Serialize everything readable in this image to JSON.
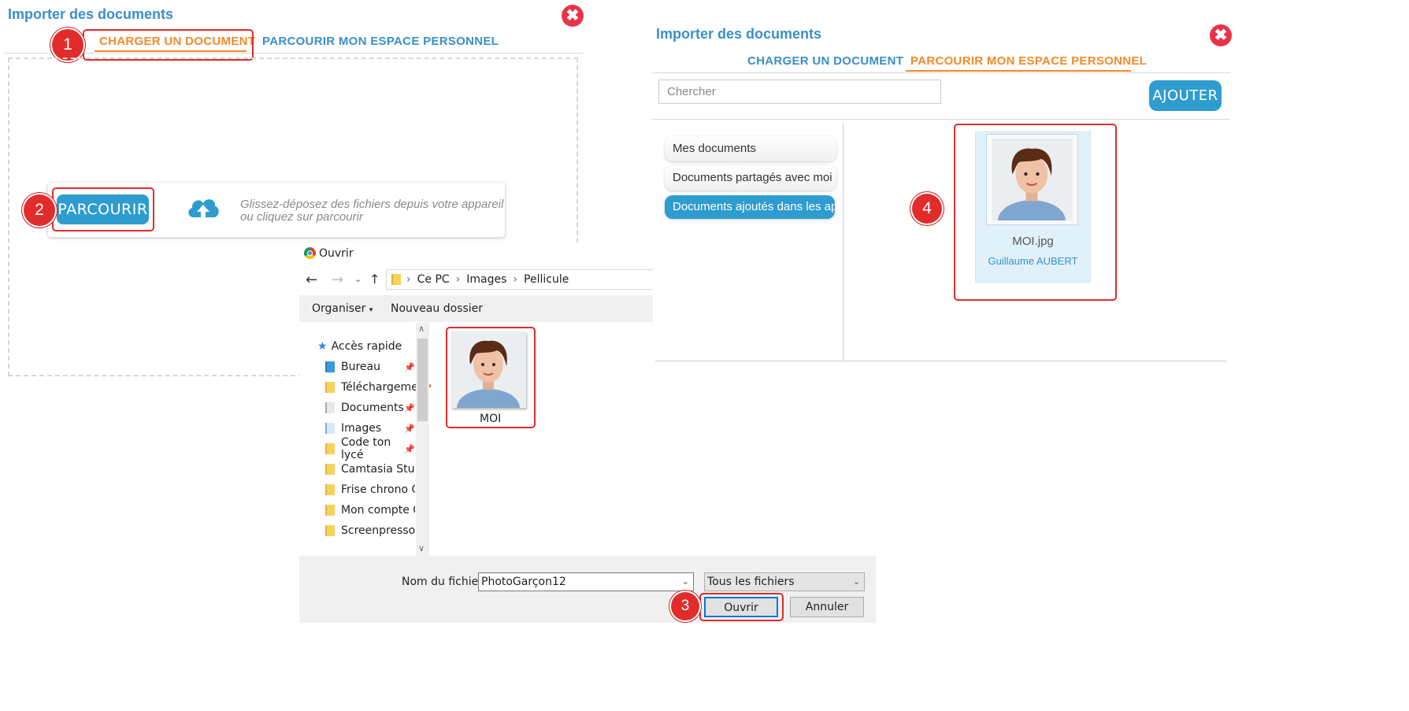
{
  "left_dialog": {
    "title": "Importer des documents",
    "close_glyph": "✖",
    "tabs": [
      {
        "label": "CHARGER UN DOCUMENT",
        "active": true
      },
      {
        "label": "PARCOURIR MON ESPACE PERSONNEL",
        "active": false
      }
    ],
    "browse_button": "PARCOURIR",
    "drop_hint_line1": "Glissez-déposez des fichiers depuis votre appareil",
    "drop_hint_line2": "ou cliquez sur parcourir"
  },
  "steps": [
    "1",
    "2",
    "3",
    "4"
  ],
  "file_dialog": {
    "title": "Ouvrir",
    "breadcrumb": [
      "Ce PC",
      "Images",
      "Pellicule"
    ],
    "toolbar": {
      "organize": "Organiser",
      "new_folder": "Nouveau dossier"
    },
    "nav": [
      {
        "label": "Accès rapide",
        "pinned": false,
        "star": true
      },
      {
        "label": "Bureau",
        "pinned": true
      },
      {
        "label": "Téléchargeme",
        "pinned": true
      },
      {
        "label": "Documents",
        "pinned": true
      },
      {
        "label": "Images",
        "pinned": true
      },
      {
        "label": "Code ton lycé",
        "pinned": true
      },
      {
        "label": "Camtasia Studio",
        "pinned": false
      },
      {
        "label": "Frise chrono ON",
        "pinned": false
      },
      {
        "label": "Mon compte ON",
        "pinned": false
      },
      {
        "label": "Screenpresso",
        "pinned": false
      }
    ],
    "file": {
      "label": "MOI"
    },
    "filename_label": "Nom du fichier :",
    "filename_value": "PhotoGarçon12",
    "filter_value": "Tous les fichiers",
    "open_button": "Ouvrir",
    "cancel_button": "Annuler"
  },
  "right_dialog": {
    "title": "Importer des documents",
    "close_glyph": "✖",
    "tabs": [
      {
        "label": "CHARGER UN DOCUMENT",
        "active": false
      },
      {
        "label": "PARCOURIR MON ESPACE PERSONNEL",
        "active": true
      }
    ],
    "search_placeholder": "Chercher",
    "add_button": "AJOUTER",
    "sidebar": [
      {
        "label": "Mes documents",
        "active": false
      },
      {
        "label": "Documents partagés avec moi",
        "active": false
      },
      {
        "label": "Documents ajoutés dans les appl",
        "active": true
      }
    ],
    "document": {
      "name": "MOI.jpg",
      "owner": "Guillaume AUBERT"
    }
  },
  "colors": {
    "accent_blue": "#3a8fc9",
    "accent_orange": "#f28a2a",
    "highlight_red": "#e02c2c",
    "button_blue": "#2f9ccf"
  }
}
